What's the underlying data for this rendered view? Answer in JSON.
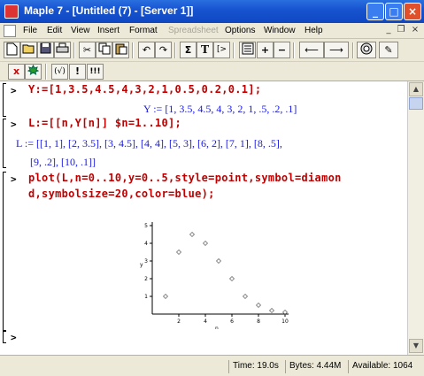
{
  "window": {
    "title": "Maple 7 - [Untitled (7) - [Server 1]]"
  },
  "menubar": {
    "items": [
      "File",
      "Edit",
      "View",
      "Insert",
      "Format",
      "Spreadsheet",
      "Options",
      "Window",
      "Help"
    ],
    "disabled": [
      "Spreadsheet"
    ]
  },
  "toolbar1": {
    "icons": [
      "new-icon",
      "open-icon",
      "save-icon",
      "print-icon",
      "cut-icon",
      "copy-icon",
      "paste-icon",
      "undo-icon",
      "redo-icon",
      "sum-icon",
      "text-icon",
      "math-input-icon",
      "insert-group-icon",
      "plus-icon",
      "minus-icon",
      "left-arrow-icon",
      "right-arrow-icon",
      "stop-icon",
      "pen-icon"
    ],
    "labels": {
      "sum": "Σ",
      "text": "T",
      "math": "[>",
      "plus": "+",
      "minus": "−"
    }
  },
  "toolbar2": {
    "labels": {
      "x": "x",
      "check": "(√)",
      "excl": "!",
      "excl3": "!!!"
    }
  },
  "worksheet": {
    "prompt": ">",
    "cmd1": "Y:=[1,3.5,4.5,4,3,2,1,0.5,0.2,0.1];",
    "out1": "Y := [1, 3.5, 4.5, 4, 3, 2, 1, .5, .2, .1]",
    "cmd2": "L:=[[n,Y[n]] $n=1..10];",
    "out2a": "L := [[1, 1], [2, 3.5], [3, 4.5], [4, 4], [5, 3], [6, 2], [7, 1], [8, .5],",
    "out2b": "[9, .2], [10, .1]]",
    "cmd3a": "plot(L,n=0..10,y=0..5,style=point,symbol=diamon",
    "cmd3b": "d,symbolsize=20,color=blue);",
    "empty_prompt": ">"
  },
  "chart_data": {
    "type": "scatter",
    "x": [
      1,
      2,
      3,
      4,
      5,
      6,
      7,
      8,
      9,
      10
    ],
    "y": [
      1,
      3.5,
      4.5,
      4,
      3,
      2,
      1,
      0.5,
      0.2,
      0.1
    ],
    "xlabel": "n",
    "ylabel": "y",
    "xlim": [
      0,
      10
    ],
    "ylim": [
      0,
      5
    ],
    "xticks": [
      "2",
      "4",
      "6",
      "8",
      "10"
    ],
    "yticks": [
      "1",
      "2",
      "3",
      "4",
      "5"
    ],
    "marker": "diamond",
    "color": "#0000ff"
  },
  "statusbar": {
    "time": "Time: 19.0s",
    "bytes": "Bytes: 4.44M",
    "available": "Available: 1064"
  },
  "colors": {
    "input": "#c00000",
    "output": "#1a1ae0",
    "titlebar": "#1854d0"
  }
}
